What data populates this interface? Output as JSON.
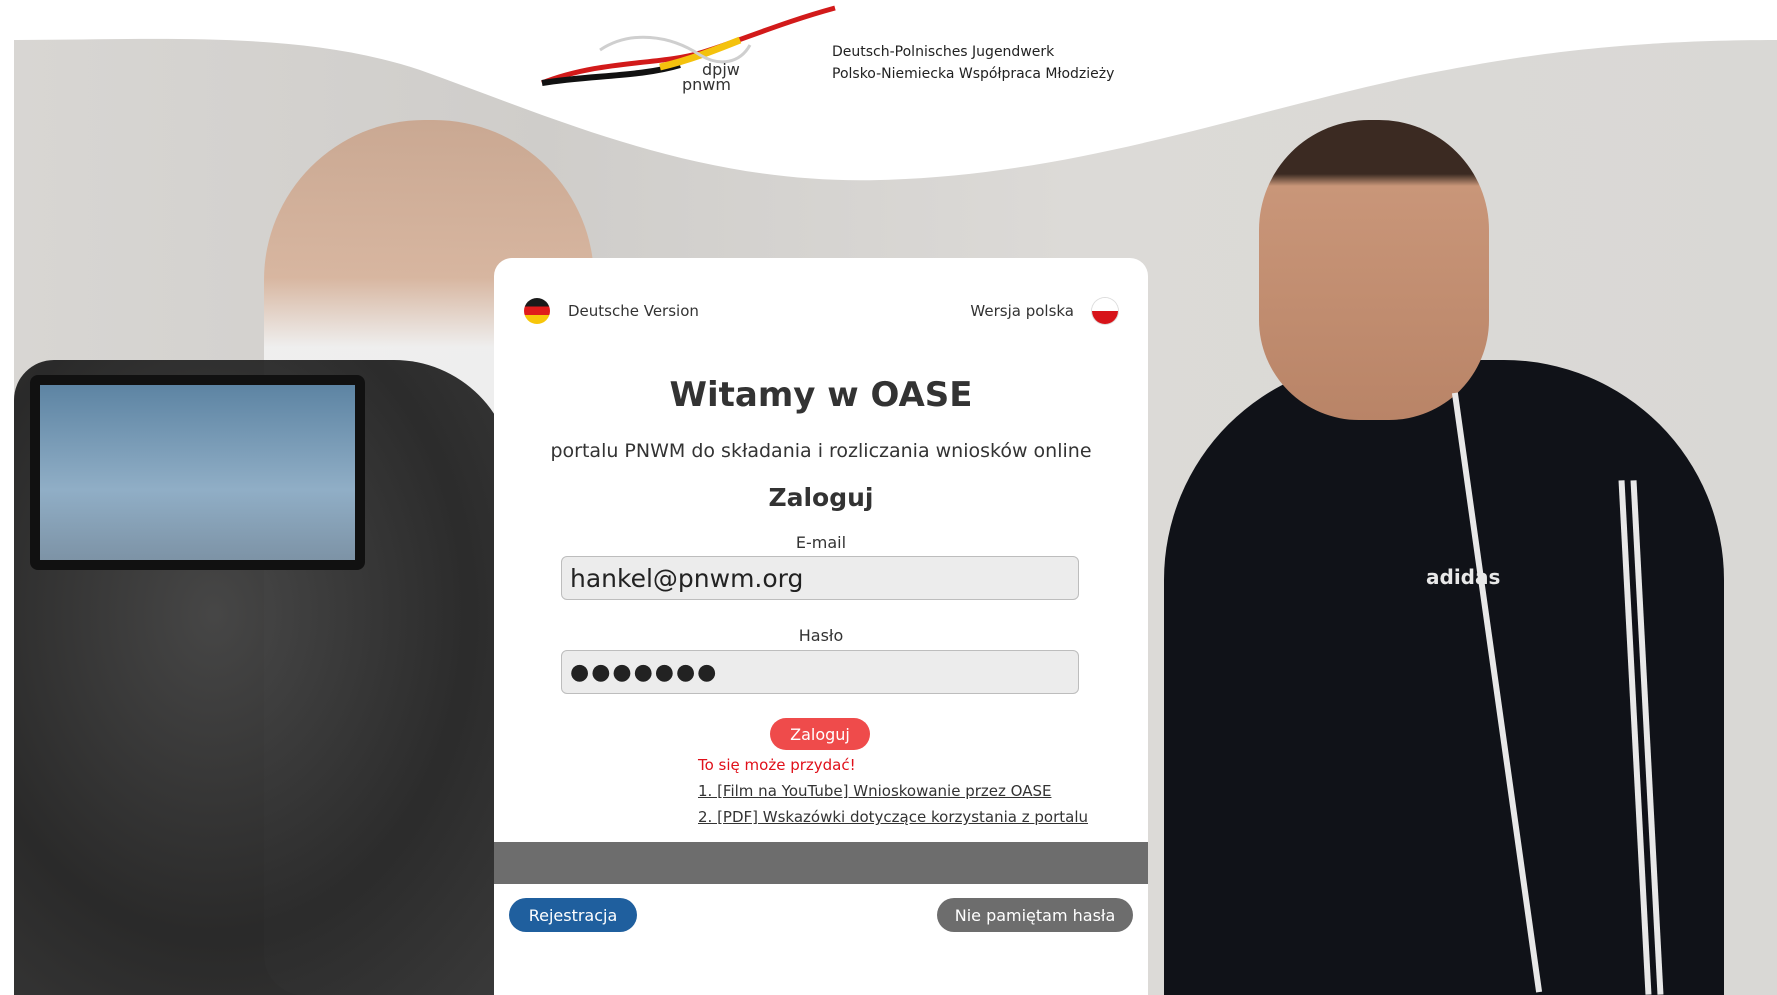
{
  "logo": {
    "short_de": "dpjw",
    "short_pl": "pnwm",
    "name_de": "Deutsch-Polnisches Jugendwerk",
    "name_pl": "Polsko-Niemiecka Współpraca Młodzieży"
  },
  "background": {
    "brand_mark": "adidas"
  },
  "languages": {
    "german": {
      "label": "Deutsche Version",
      "icon": "flag-de-icon"
    },
    "polish": {
      "label": "Wersja polska",
      "icon": "flag-pl-icon"
    }
  },
  "header": {
    "title": "Witamy w OASE",
    "subtitle": "portalu PNWM do składania i rozliczania wniosków online",
    "login_heading": "Zaloguj"
  },
  "form": {
    "email_label": "E-mail",
    "email_value": "hankel@pnwm.org",
    "password_label": "Hasło",
    "password_value": "●●●●●●●",
    "submit_label": "Zaloguj"
  },
  "help": {
    "hint": "To się może przydać!",
    "links": [
      "1. [Film na YouTube] Wnioskowanie przez OASE",
      "2. [PDF] Wskazówki dotyczące korzystania z portalu"
    ]
  },
  "footer": {
    "register_label": "Rejestracja",
    "forgot_label": "Nie pamiętam hasła"
  },
  "colors": {
    "primary_red": "#ef4b4b",
    "register_blue": "#1f5f9e",
    "footer_gray": "#6d6d6d",
    "hint_red": "#e0101a"
  }
}
